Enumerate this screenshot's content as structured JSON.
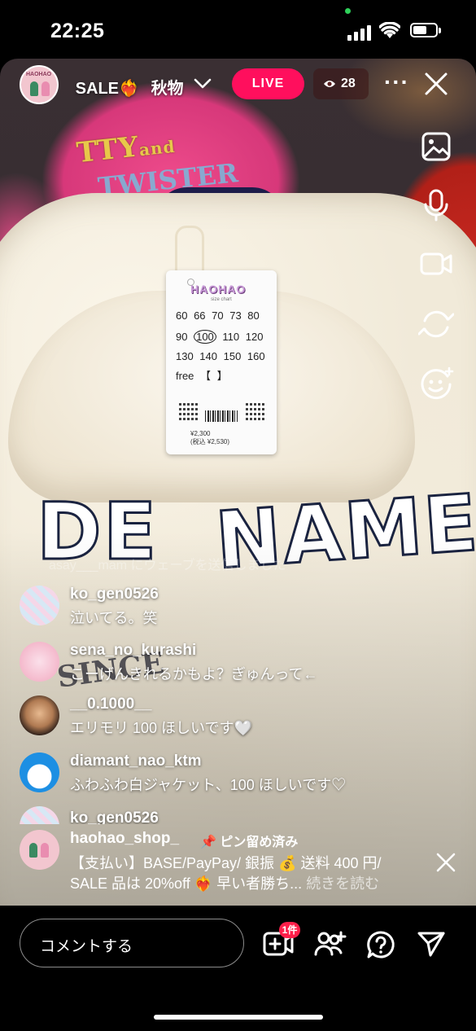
{
  "status_bar": {
    "time": "22:25"
  },
  "header": {
    "title_part1": "SALE",
    "title_part2": "秋物",
    "live_label": "LIVE",
    "viewer_count": "28"
  },
  "tag": {
    "brand": "HAOHAO",
    "size_chart_label": "size chart",
    "rows": [
      "60  66  70  73  80",
      "90",
      "100",
      "110  120",
      "130  140  150  160",
      "free  【        】"
    ],
    "price": "¥2,300",
    "price_tax": "(税込 ¥2,530)"
  },
  "print": {
    "word1": "DE",
    "word2": "NAME"
  },
  "ghost_text": "asay___mam にウェーブを送信しました",
  "comments": [
    {
      "user": "ko_gen0526",
      "message": "泣いてる。笑"
    },
    {
      "user": "sena_no_kurashi",
      "message": "こーげんきれるかもよ？ぎゅんって←"
    },
    {
      "user": "__0.1000__",
      "message": "エリモリ 100 ほしいです🤍"
    },
    {
      "user": "diamant_nao_ktm",
      "message": "ふわふわ白ジャケット、100 ほしいです♡"
    },
    {
      "user": "ko_gen0526",
      "message": ""
    }
  ],
  "pinned": {
    "user": "haohao_shop_",
    "pin_label": "ピン留め済み",
    "line1": "【支払い】BASE/PayPay/ 銀振 💰 送料 400 円/",
    "line2": "SALE 品は 20%off ❤️‍🔥 早い者勝ち...",
    "more": "続きを読む"
  },
  "bottom": {
    "comment_placeholder": "コメントする",
    "badge": "1件"
  },
  "colors": {
    "live": "#ff0f5d",
    "badge": "#ff1f4a"
  }
}
